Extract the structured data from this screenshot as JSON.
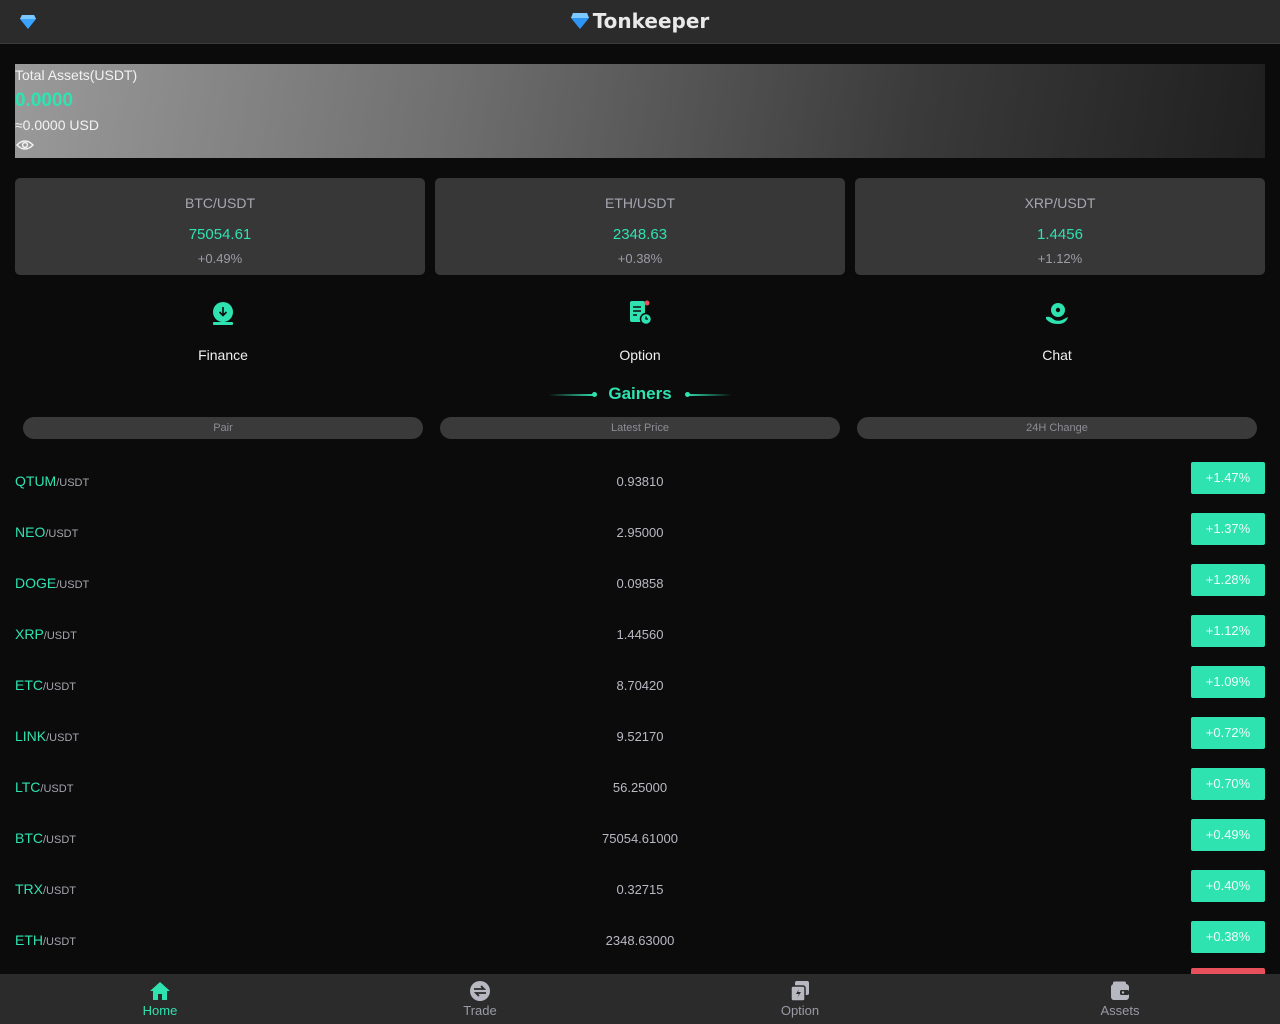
{
  "header": {
    "brand": "Tonkeeper",
    "menu_icon": "gem-icon",
    "brand_icon": "gem-icon"
  },
  "assets": {
    "label": "Total Assets(USDT)",
    "amount": "0.0000",
    "usd": "≈0.0000 USD",
    "toggle_icon": "eye-icon"
  },
  "tickers": [
    {
      "pair": "BTC/USDT",
      "price": "75054.61",
      "change": "+0.49%"
    },
    {
      "pair": "ETH/USDT",
      "price": "2348.63",
      "change": "+0.38%"
    },
    {
      "pair": "XRP/USDT",
      "price": "1.4456",
      "change": "+1.12%"
    }
  ],
  "shortcuts": [
    {
      "label": "Finance",
      "icon": "download-coin-icon"
    },
    {
      "label": "Option",
      "icon": "document-clock-icon"
    },
    {
      "label": "Chat",
      "icon": "support-agent-icon"
    }
  ],
  "gainers": {
    "title": "Gainers",
    "columns": [
      "Pair",
      "Latest Price",
      "24H Change"
    ],
    "rows": [
      {
        "base": "QTUM",
        "quote": "/USDT",
        "price": "0.93810",
        "change": "+1.47%"
      },
      {
        "base": "NEO",
        "quote": "/USDT",
        "price": "2.95000",
        "change": "+1.37%"
      },
      {
        "base": "DOGE",
        "quote": "/USDT",
        "price": "0.09858",
        "change": "+1.28%"
      },
      {
        "base": "XRP",
        "quote": "/USDT",
        "price": "1.44560",
        "change": "+1.12%"
      },
      {
        "base": "ETC",
        "quote": "/USDT",
        "price": "8.70420",
        "change": "+1.09%"
      },
      {
        "base": "LINK",
        "quote": "/USDT",
        "price": "9.52170",
        "change": "+0.72%"
      },
      {
        "base": "LTC",
        "quote": "/USDT",
        "price": "56.25000",
        "change": "+0.70%"
      },
      {
        "base": "BTC",
        "quote": "/USDT",
        "price": "75054.61000",
        "change": "+0.49%"
      },
      {
        "base": "TRX",
        "quote": "/USDT",
        "price": "0.32715",
        "change": "+0.40%"
      },
      {
        "base": "ETH",
        "quote": "/USDT",
        "price": "2348.63000",
        "change": "+0.38%"
      }
    ]
  },
  "tabbar": [
    {
      "label": "Home",
      "icon": "home-icon",
      "active": true
    },
    {
      "label": "Trade",
      "icon": "exchange-icon",
      "active": false
    },
    {
      "label": "Option",
      "icon": "option-icon",
      "active": false
    },
    {
      "label": "Assets",
      "icon": "wallet-icon",
      "active": false
    }
  ],
  "colors": {
    "accent": "#2ee3b0",
    "negative": "#e8505b",
    "surface": "#373738",
    "background": "#0b0b0c"
  }
}
